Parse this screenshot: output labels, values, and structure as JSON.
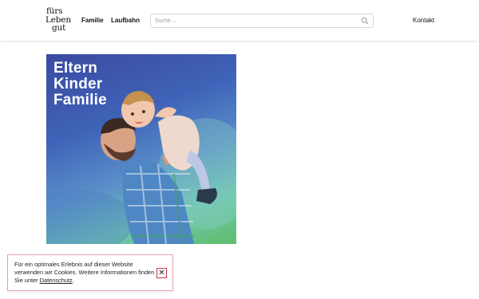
{
  "header": {
    "logo_lines": [
      "fürs",
      "Leben",
      "gut"
    ],
    "nav": {
      "familie": "Familie",
      "laufbahn": "Laufbahn"
    },
    "search": {
      "placeholder": "Suche ...",
      "icon": "search-icon"
    },
    "kontakt": "Kontakt"
  },
  "hero": {
    "title_lines": [
      "Eltern",
      "Kinder",
      "Familie"
    ]
  },
  "cookie_banner": {
    "text": "Für ein optimales Erlebnis auf dieser Website verwenden wir Cookies. Weitere Informationen finden Sie unter ",
    "link_label": "Datenschutz",
    "suffix": ".",
    "close_symbol": "✕",
    "border_color": "#e4a6ae",
    "close_color": "#c23b4b"
  }
}
